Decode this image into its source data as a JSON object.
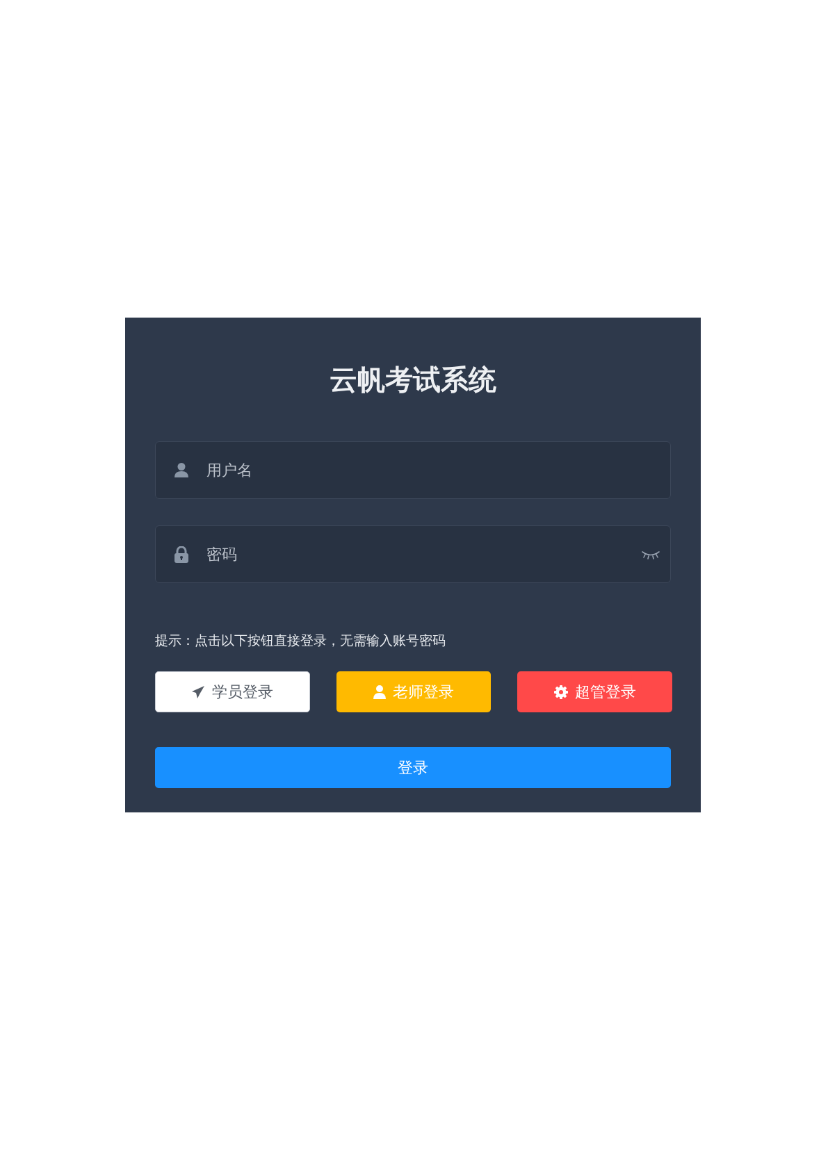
{
  "title": "云帆考试系统",
  "fields": [
    {
      "kind": "username",
      "placeholder": "用户名"
    },
    {
      "kind": "password",
      "placeholder": "密码"
    }
  ],
  "hint": "提示：点击以下按钮直接登录，无需输入账号密码",
  "quick_logins": [
    {
      "kind": "student",
      "label": "学员登录",
      "color": "#ffffff"
    },
    {
      "kind": "teacher",
      "label": "老师登录",
      "color": "#ffba00"
    },
    {
      "kind": "admin",
      "label": "超管登录",
      "color": "#ff4949"
    }
  ],
  "login_button": "登录"
}
